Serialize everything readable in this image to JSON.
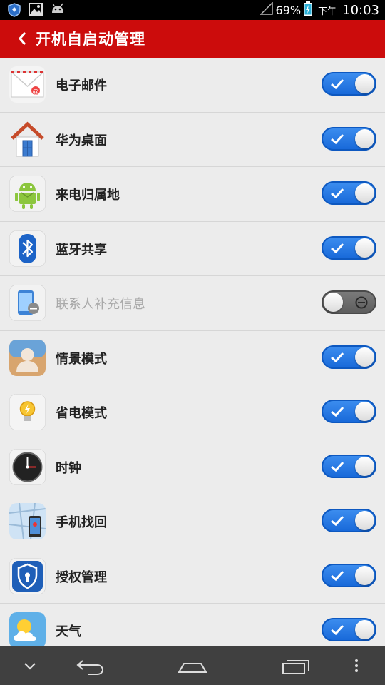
{
  "status": {
    "battery": "69%",
    "ampm": "下午",
    "time": "10:03",
    "icons": [
      "shield-icon",
      "image-icon",
      "android-icon"
    ]
  },
  "header": {
    "title": "开机自启动管理",
    "back_icon": "back-arrow-icon"
  },
  "apps": [
    {
      "label": "电子邮件",
      "enabled": true,
      "icon": "mail-icon"
    },
    {
      "label": "华为桌面",
      "enabled": true,
      "icon": "home-icon"
    },
    {
      "label": "来电归属地",
      "enabled": true,
      "icon": "android-icon"
    },
    {
      "label": "蓝牙共享",
      "enabled": true,
      "icon": "bluetooth-icon"
    },
    {
      "label": "联系人补充信息",
      "enabled": false,
      "icon": "contact-sync-icon"
    },
    {
      "label": "情景模式",
      "enabled": true,
      "icon": "profile-icon"
    },
    {
      "label": "省电模式",
      "enabled": true,
      "icon": "bulb-icon"
    },
    {
      "label": "时钟",
      "enabled": true,
      "icon": "clock-icon"
    },
    {
      "label": "手机找回",
      "enabled": true,
      "icon": "map-phone-icon"
    },
    {
      "label": "授权管理",
      "enabled": true,
      "icon": "shield-lock-icon"
    },
    {
      "label": "天气",
      "enabled": true,
      "icon": "weather-icon"
    }
  ],
  "colors": {
    "header_bg": "#cc0c0c",
    "switch_on": "#1f74e4",
    "switch_off": "#666666",
    "navbar_bg": "#404040"
  },
  "navbar": [
    "chevron-down-icon",
    "back-icon",
    "home-icon",
    "recent-apps-icon",
    "more-icon"
  ]
}
